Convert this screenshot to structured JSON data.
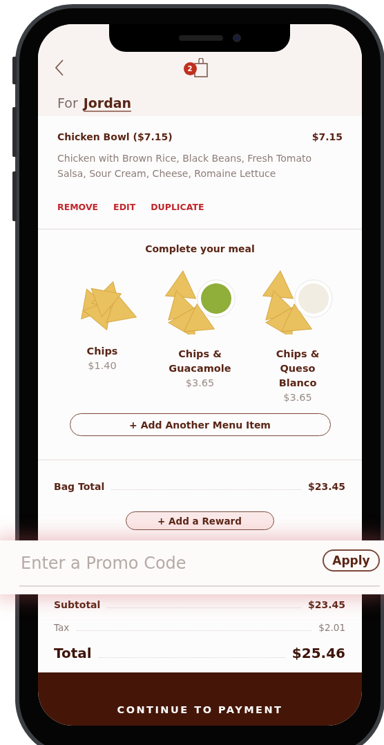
{
  "header": {
    "bag_count": "2"
  },
  "for_label": "For",
  "customer": "Jordan",
  "item": {
    "title": "Chicken Bowl ($7.15)",
    "price": "$7.15",
    "description": "Chicken with Brown Rice, Black Beans, Fresh Tomato Salsa, Sour Cream, Cheese, Romaine Lettuce",
    "actions": [
      "REMOVE",
      "EDIT",
      "DUPLICATE"
    ]
  },
  "upsell": {
    "title": "Complete your meal",
    "items": [
      {
        "kind": "chips",
        "name": "Chips",
        "price": "$1.40"
      },
      {
        "kind": "guacamole",
        "name": "Chips & Guacamole",
        "price": "$3.65"
      },
      {
        "kind": "queso",
        "name": "Chips & Queso Blanco",
        "price": "$3.65"
      }
    ],
    "add_button": "+ Add Another Menu Item"
  },
  "bag_total": {
    "label": "Bag Total",
    "value": "$23.45"
  },
  "reward_button": "+ Add a Reward",
  "promo": {
    "placeholder": "Enter a Promo Code",
    "button": "Apply"
  },
  "summary": [
    {
      "kind": "subtotal",
      "label": "Subtotal",
      "value": "$23.45"
    },
    {
      "kind": "tax",
      "label": "Tax",
      "value": "$2.01"
    },
    {
      "kind": "total",
      "label": "Total",
      "value": "$25.46"
    }
  ],
  "cta": "CONTINUE TO PAYMENT"
}
